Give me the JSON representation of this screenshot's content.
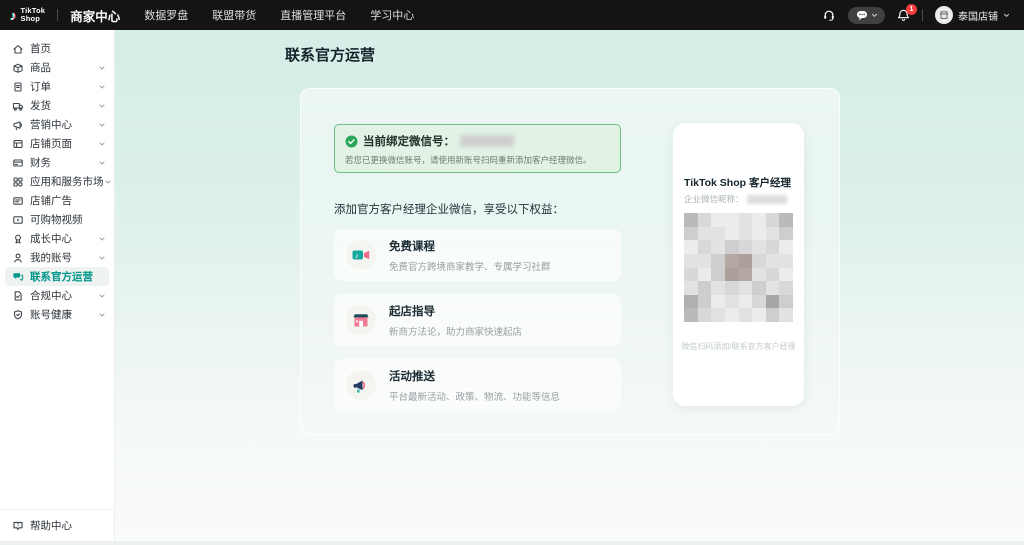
{
  "topbar": {
    "logo": {
      "line1": "TikTok",
      "line2": "Shop"
    },
    "nav": [
      {
        "label": "商家中心",
        "active": true
      },
      {
        "label": "数据罗盘",
        "active": false
      },
      {
        "label": "联盟带货",
        "active": false
      },
      {
        "label": "直播管理平台",
        "active": false
      },
      {
        "label": "学习中心",
        "active": false
      }
    ],
    "notification_count": "1",
    "store": {
      "name": "泰国店铺"
    }
  },
  "sidebar": {
    "items": [
      {
        "label": "首页",
        "icon": "home",
        "expandable": false,
        "active": false
      },
      {
        "label": "商品",
        "icon": "product",
        "expandable": true,
        "active": false
      },
      {
        "label": "订单",
        "icon": "order",
        "expandable": true,
        "active": false
      },
      {
        "label": "发货",
        "icon": "shipping",
        "expandable": true,
        "active": false
      },
      {
        "label": "营销中心",
        "icon": "marketing",
        "expandable": true,
        "active": false
      },
      {
        "label": "店铺页面",
        "icon": "store-page",
        "expandable": true,
        "active": false
      },
      {
        "label": "财务",
        "icon": "finance",
        "expandable": true,
        "active": false
      },
      {
        "label": "应用和服务市场",
        "icon": "apps-market",
        "expandable": true,
        "active": false
      },
      {
        "label": "店铺广告",
        "icon": "shop-ads",
        "expandable": false,
        "active": false
      },
      {
        "label": "可购物视频",
        "icon": "shoppable-video",
        "expandable": false,
        "active": false
      },
      {
        "label": "成长中心",
        "icon": "growth-center",
        "expandable": true,
        "active": false
      },
      {
        "label": "我的账号",
        "icon": "my-account",
        "expandable": true,
        "active": false
      },
      {
        "label": "联系官方运营",
        "icon": "contact-official",
        "expandable": false,
        "active": true
      },
      {
        "label": "合规中心",
        "icon": "compliance-center",
        "expandable": true,
        "active": false
      },
      {
        "label": "账号健康",
        "icon": "account-health",
        "expandable": true,
        "active": false
      }
    ],
    "help": {
      "label": "帮助中心",
      "icon": "help-center"
    }
  },
  "main": {
    "title": "联系官方运营",
    "binding_banner": {
      "label": "当前绑定微信号：",
      "note": "若您已更换微信账号，请使用新账号扫码重新添加客户经理微信。"
    },
    "benefits_heading": "添加官方客户经理企业微信，享受以下权益：",
    "benefits": [
      {
        "title": "免费课程",
        "desc": "免费官方跨境商家教学、专属学习社群",
        "icon": "free-course"
      },
      {
        "title": "起店指导",
        "desc": "新商方法论，助力商家快速起店",
        "icon": "store-guide"
      },
      {
        "title": "活动推送",
        "desc": "平台最新活动、政策、物流、功能等信息",
        "icon": "activity-push"
      }
    ],
    "qr_card": {
      "title": "TikTok Shop 客户经理",
      "nickname_label": "企业微信昵称：",
      "footer": "微信扫码添加/联系官方客户经理"
    }
  },
  "colors": {
    "accent_teal": "#00968a",
    "topbar_black": "#141414",
    "success_green": "#2aa65a",
    "banner_bg": "#e2f3e6",
    "banner_border": "#6fbe85",
    "badge_red": "#f23c3c"
  }
}
